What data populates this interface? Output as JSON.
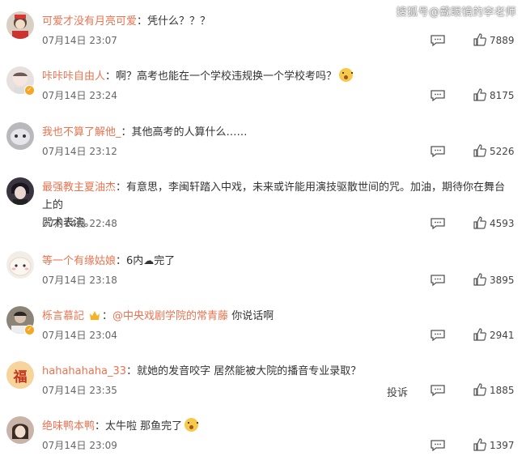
{
  "watermark": "搜狐号@戴眼镜的李老师",
  "comments": [
    {
      "username": "可爱才没有月亮可爱",
      "text": "凭什么？？？",
      "time": "07月14日 23:07",
      "likes": "7889",
      "avatar_color": "#d9cfc2"
    },
    {
      "username": "咔咔咔自由人",
      "text": "啊？高考也能在一个学校违规换一个学校考吗？",
      "time": "07月14日 23:24",
      "likes": "8175",
      "avatar_color": "#e8e0de"
    },
    {
      "username": "我也不算了解他_",
      "text": "其他高考的人算什么……",
      "time": "07月14日 23:12",
      "likes": "5226",
      "avatar_color": "#b9b9bd"
    },
    {
      "username": "最强教主夏油杰",
      "text": "有意思，李闽轩踏入中戏，未来或许能用演技驱散世间的咒。加油，期待你在舞台上的",
      "text2": "咒术表演。",
      "time": "07月14日 22:48",
      "likes": "4593",
      "avatar_color": "#3a3340"
    },
    {
      "username": "等一个有缘姑娘",
      "text": "6内☁完了",
      "time": "07月14日 23:18",
      "likes": "3895",
      "avatar_color": "#f2ede6"
    },
    {
      "username": "栎言慕記",
      "mention": "@中央戏剧学院的常青藤",
      "text": "你说话啊",
      "time": "07月14日 23:04",
      "likes": "2941",
      "avatar_color": "#8c8577"
    },
    {
      "username": "hahahahaha_33",
      "text": "就她的发音咬字 居然能被大院的播音专业录取？",
      "time": "07月14日 23:35",
      "likes": "1885",
      "report": "投诉",
      "avatar_color": "#f6d49b",
      "avatar_char": "福"
    },
    {
      "username": "绝味鸭本鸭",
      "text": "太牛啦 那鱼完了",
      "time": "07月14日 23:09",
      "likes": "1397",
      "avatar_color": "#c8b4a8"
    }
  ],
  "icons": {
    "reply": "comment-icon",
    "like": "thumbs-up-icon",
    "verified": "verified-badge-icon"
  }
}
